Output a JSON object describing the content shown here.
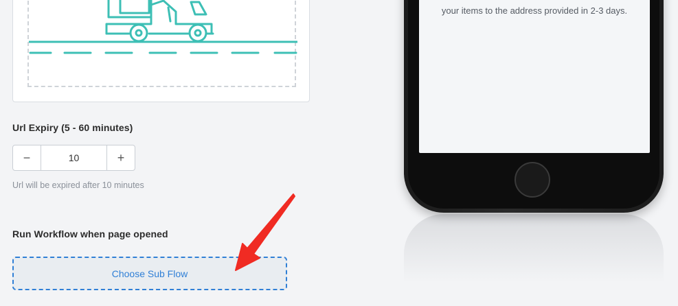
{
  "form": {
    "url_expiry": {
      "label": "Url Expiry (5 - 60 minutes)",
      "value": "10",
      "minus_symbol": "−",
      "plus_symbol": "+",
      "hint": "Url will be expired after 10 minutes"
    },
    "workflow": {
      "label": "Run Workflow when page opened",
      "choose_button": "Choose Sub Flow"
    }
  },
  "preview": {
    "screen_text": "your items to the address provided in 2-3 days."
  },
  "colors": {
    "truck": "#3dbfb5",
    "accent": "#2f7fd6",
    "arrow": "#f02b23"
  }
}
